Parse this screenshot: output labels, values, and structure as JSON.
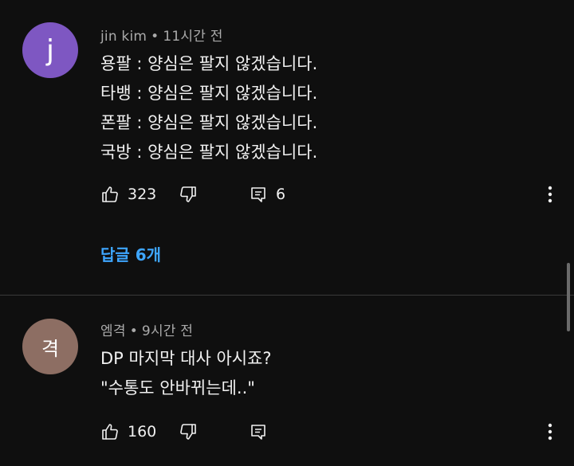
{
  "comments": [
    {
      "author": "jin kim",
      "separator": "•",
      "time": "11시간 전",
      "avatar_letter": "j",
      "avatar_color": "#7e57c2",
      "lines": [
        "용팔 : 양심은 팔지 않겠습니다.",
        "타뱅 : 양심은 팔지 않겠습니다.",
        "폰팔 : 양심은 팔지 않겠습니다.",
        "국방 : 양심은 팔지 않겠습니다."
      ],
      "likes": "323",
      "replies_count": "6",
      "replies_link": "답글 6개",
      "icons": {
        "like": "thumb-up-icon",
        "dislike": "thumb-down-icon",
        "reply": "comment-reply-icon",
        "more": "more-vert-icon"
      }
    },
    {
      "author": "엠격",
      "separator": "•",
      "time": "9시간 전",
      "avatar_letter": "격",
      "avatar_color": "#8d6e63",
      "lines": [
        "DP 마지막 대사 아시죠?",
        "\"수통도 안바뀌는데..\""
      ],
      "likes": "160",
      "icons": {
        "like": "thumb-up-icon",
        "dislike": "thumb-down-icon",
        "reply": "comment-reply-icon",
        "more": "more-vert-icon"
      }
    }
  ],
  "colors": {
    "background": "#0f0f0f",
    "text": "#f1f1f1",
    "meta": "#aaaaaa",
    "link": "#3ea6ff"
  }
}
